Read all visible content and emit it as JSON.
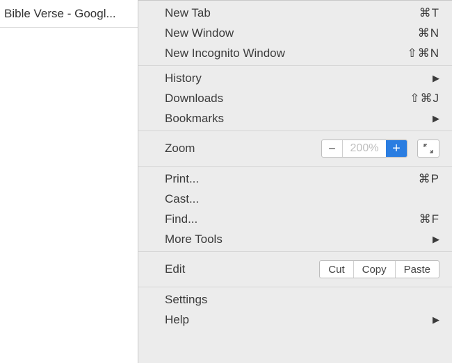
{
  "tab": {
    "title": "Bible Verse - Googl..."
  },
  "menu": {
    "section1": {
      "new_tab": {
        "label": "New Tab",
        "shortcut": "⌘T"
      },
      "new_window": {
        "label": "New Window",
        "shortcut": "⌘N"
      },
      "new_incognito": {
        "label": "New Incognito Window",
        "shortcut": "⇧⌘N"
      }
    },
    "section2": {
      "history": {
        "label": "History"
      },
      "downloads": {
        "label": "Downloads",
        "shortcut": "⇧⌘J"
      },
      "bookmarks": {
        "label": "Bookmarks"
      }
    },
    "section3": {
      "zoom": {
        "label": "Zoom",
        "value": "200%"
      }
    },
    "section4": {
      "print": {
        "label": "Print...",
        "shortcut": "⌘P"
      },
      "cast": {
        "label": "Cast..."
      },
      "find": {
        "label": "Find...",
        "shortcut": "⌘F"
      },
      "more_tools": {
        "label": "More Tools"
      }
    },
    "section5": {
      "edit": {
        "label": "Edit",
        "cut": "Cut",
        "copy": "Copy",
        "paste": "Paste"
      }
    },
    "section6": {
      "settings": {
        "label": "Settings"
      },
      "help": {
        "label": "Help"
      }
    }
  }
}
